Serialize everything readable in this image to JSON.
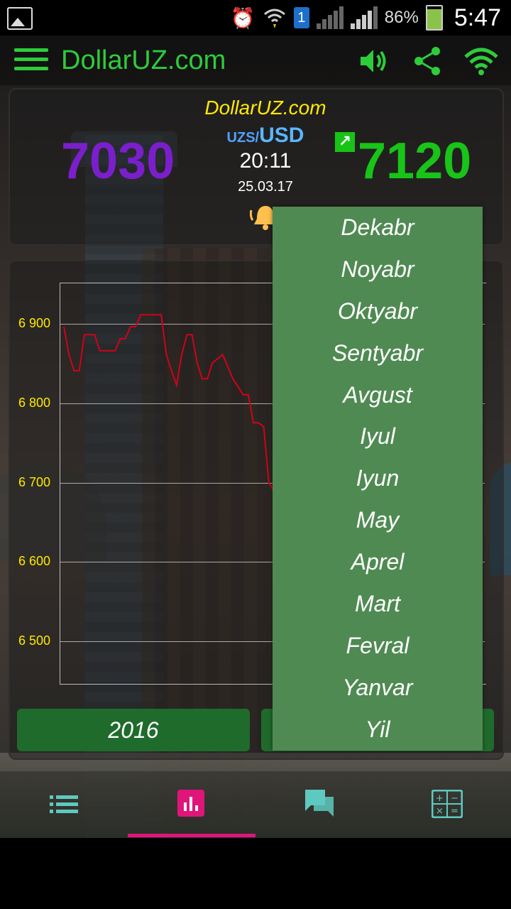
{
  "status_bar": {
    "battery_percent": "86%",
    "battery_level": 0.86,
    "time": "5:47",
    "sim_slot": "1"
  },
  "app_bar": {
    "title": "DollarUZ.com",
    "accent": "#2ecc3b"
  },
  "rate_card": {
    "brand": "DollarUZ.com",
    "pair_base": "UZS/",
    "pair_quote": "USD",
    "buy": "7030",
    "sell": "7120",
    "time": "20:11",
    "date": "25.03.17",
    "trend_icon": "arrow-up-right-icon"
  },
  "chart": {
    "y_ticks": [
      "6 900",
      "6 800",
      "6 700",
      "6 600",
      "6 500"
    ]
  },
  "chart_data": {
    "type": "line",
    "ylim": [
      6450,
      6950
    ],
    "y_ticks": [
      6900,
      6800,
      6700,
      6600,
      6500
    ],
    "series": [
      {
        "color": "#d0021b",
        "values": [
          6895,
          6860,
          6840,
          6840,
          6885,
          6885,
          6885,
          6865,
          6865,
          6865,
          6865,
          6880,
          6880,
          6895,
          6895,
          6910,
          6910,
          6910,
          6910,
          6910,
          6860,
          6840,
          6822,
          6860,
          6885,
          6885,
          6850,
          6830,
          6830,
          6850,
          6855,
          6860,
          6845,
          6830,
          6820,
          6810,
          6810,
          6775,
          6775,
          6770,
          6700,
          6690
        ]
      }
    ]
  },
  "buttons": {
    "year": "2016"
  },
  "month_menu": {
    "items": [
      "Dekabr",
      "Noyabr",
      "Oktyabr",
      "Sentyabr",
      "Avgust",
      "Iyul",
      "Iyun",
      "May",
      "Aprel",
      "Mart",
      "Fevral",
      "Yanvar",
      "Yil"
    ]
  },
  "bottom_nav": {
    "tabs": [
      "list-icon",
      "bar-chart-icon",
      "chat-icon",
      "calculator-icon"
    ],
    "active_index": 1,
    "active_color": "#e0157a"
  }
}
